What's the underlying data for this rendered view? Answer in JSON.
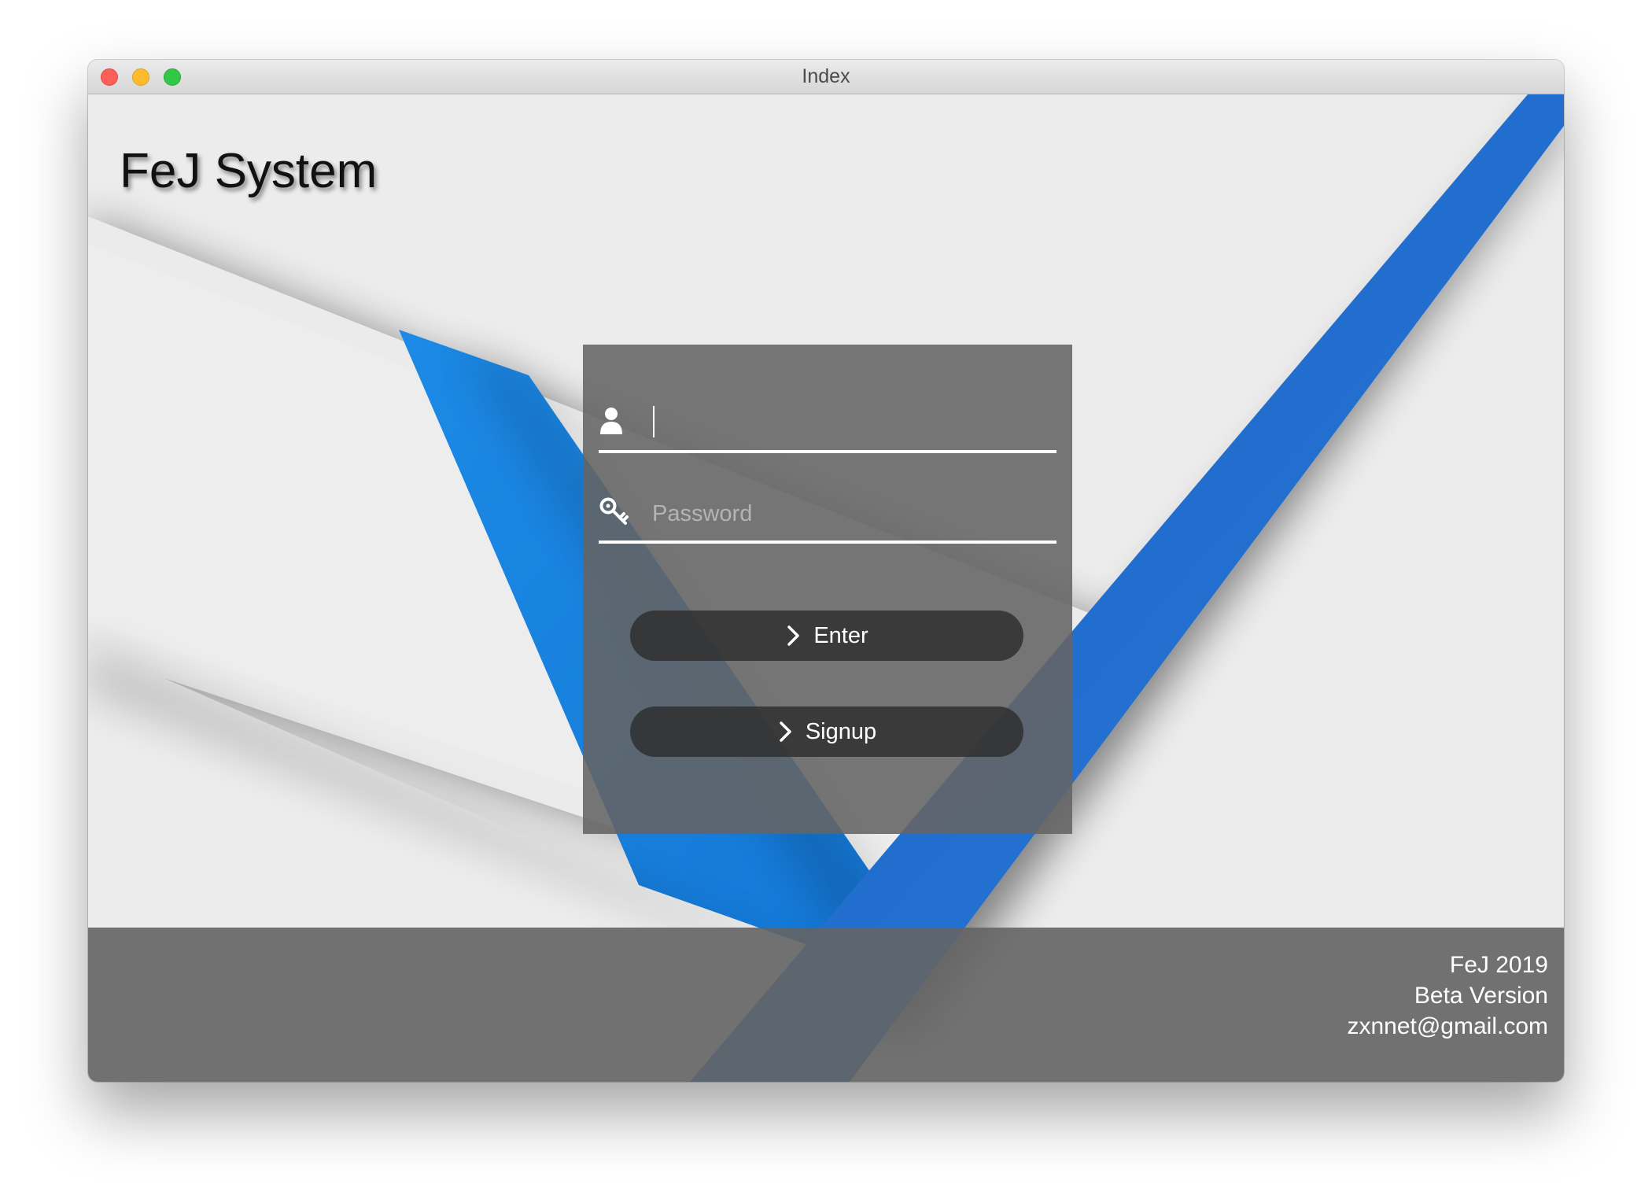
{
  "window": {
    "title": "Index"
  },
  "app": {
    "title": "FeJ System"
  },
  "login": {
    "username_value": "",
    "username_placeholder": "",
    "password_placeholder": "Password",
    "enter_label": "Enter",
    "signup_label": "Signup",
    "icons": {
      "username": "user-icon",
      "password": "key-icon",
      "button": "chevron-right-icon"
    }
  },
  "footer": {
    "line1": "FeJ 2019",
    "line2": "Beta Version",
    "line3": "zxnnet@gmail.com"
  },
  "colors": {
    "background": "#ececec",
    "accent_blue": "#1b82dc",
    "accent_blue_dark": "#1f5fbf",
    "panel": "#646464",
    "button": "#2d2d2d"
  }
}
